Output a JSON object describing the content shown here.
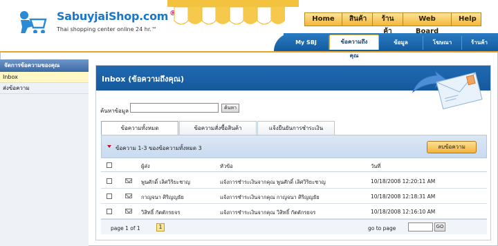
{
  "header": {
    "logo_title": "SabuyjaiShop.com",
    "logo_reg": "®",
    "logo_subtitle": "Thai shopping center online 24 hr.™"
  },
  "top_nav": {
    "items": [
      {
        "label": "Home"
      },
      {
        "label": "สินค้า"
      },
      {
        "label": "ร้านค้า"
      },
      {
        "label": "Web Board"
      },
      {
        "label": "Help"
      }
    ]
  },
  "sub_nav": {
    "items": [
      {
        "label": "My SBJ"
      },
      {
        "label": "ข้อความถึงคุณ"
      },
      {
        "label": "ข้อมูลบุคคล"
      },
      {
        "label": "โฆษณา"
      },
      {
        "label": "ร้านค้า"
      }
    ]
  },
  "sidebar": {
    "heading": "จัดการข้อความของคุณ",
    "items": [
      {
        "label": "Inbox"
      },
      {
        "label": "ส่งข้อความ"
      }
    ]
  },
  "main": {
    "title": "Inbox (ข้อความถึงคุณ)",
    "search": {
      "label": "ค้นหาข้อมูล",
      "value": "",
      "button": "ค้นหา"
    },
    "tabs": [
      {
        "label": "ข้อความทั้งหมด"
      },
      {
        "label": "ข้อความสั่งซื้อสินค้า"
      },
      {
        "label": "แจ้งยืนยันการชำระเงิน"
      }
    ],
    "list_count": "ข้อความ 1-3 ของข้อความทั้งหมด 3",
    "delete_button": "ลบข้อความ",
    "columns": {
      "sender": "ผู้ส่ง",
      "subject": "หัวข้อ",
      "date": "วันที่"
    },
    "rows": [
      {
        "sender": "พูนศักดิ์ เลิศวิริยะชาญ",
        "subject": "แจ้งการชำระเงินจากคุณ พูนศักดิ์ เลิศวิริยะชาญ",
        "date": "10/18/2008 12:20:11 AM"
      },
      {
        "sender": "กาญจนา ศิริญญธัย",
        "subject": "แจ้งการชำระเงินจากคุณ กาญจนา ศิริญญธัย",
        "date": "10/18/2008 12:18:31 AM"
      },
      {
        "sender": "วิสิทธิ์ กัตตักรยจร",
        "subject": "แจ้งการชำระเงินจากคุณ วิสิทธิ์ กัตตักรยจร",
        "date": "10/18/2008 12:16:10 AM"
      }
    ],
    "pager": {
      "page_of": "page 1 of 1",
      "current": "1",
      "goto_label": "go to page",
      "goto_value": "",
      "goto_button": "GO"
    }
  },
  "colors": {
    "accent_blue": "#1a5fa6",
    "accent_orange": "#f3b737",
    "logo_blue": "#1a77c9"
  }
}
